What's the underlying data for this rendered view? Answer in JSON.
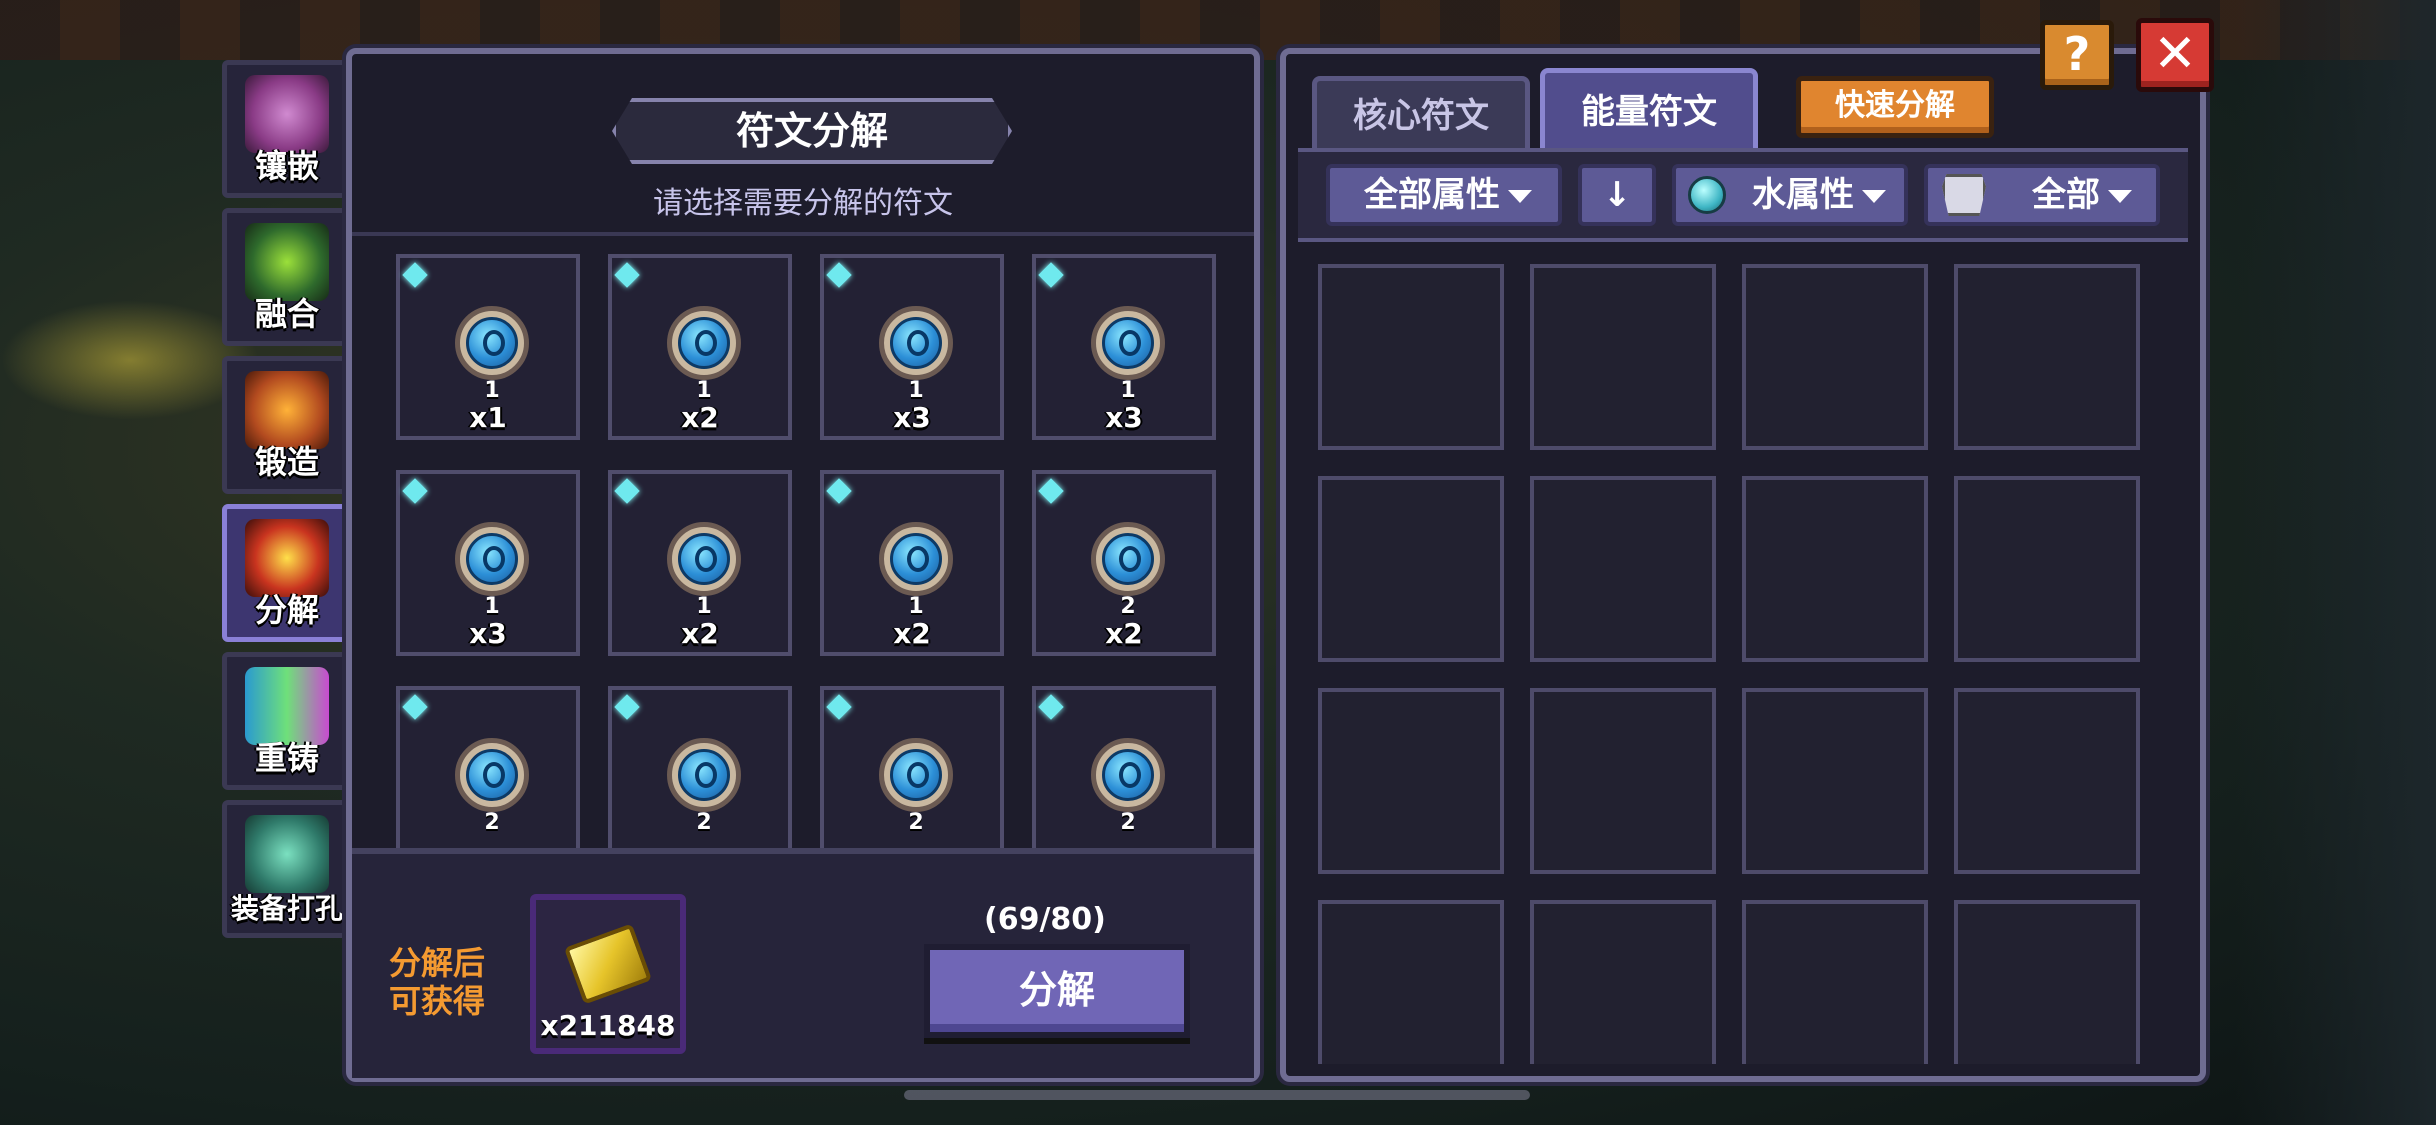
{
  "colors": {
    "panel_bg": "#1d1c2b",
    "panel_border": "#6f6c92",
    "accent_purple": "#7066b6",
    "accent_orange": "#e0852f",
    "close_red": "#d63a34",
    "rune_gem_cyan": "#6fe9ee"
  },
  "side_nav": {
    "items": [
      {
        "label": "镶嵌",
        "icon": "inlay-icon",
        "art": "#8a3b86"
      },
      {
        "label": "融合",
        "icon": "fusion-icon",
        "art": "#2e6a2c"
      },
      {
        "label": "锻造",
        "icon": "forge-icon",
        "art": "#b24a1f"
      },
      {
        "label": "分解",
        "icon": "decompose-icon",
        "art": "#c9341f",
        "active": true
      },
      {
        "label": "重铸",
        "icon": "recast-icon",
        "art": "#3f8a57"
      },
      {
        "label": "装备打孔",
        "icon": "socket-punch-icon",
        "art": "#2f7a6a"
      }
    ]
  },
  "decompose_panel": {
    "title": "符文分解",
    "subtitle": "请选择需要分解的符文",
    "runes": [
      {
        "level": "1",
        "qty": "x1"
      },
      {
        "level": "1",
        "qty": "x2"
      },
      {
        "level": "1",
        "qty": "x3"
      },
      {
        "level": "1",
        "qty": "x3"
      },
      {
        "level": "1",
        "qty": "x3"
      },
      {
        "level": "1",
        "qty": "x2"
      },
      {
        "level": "1",
        "qty": "x2"
      },
      {
        "level": "2",
        "qty": "x2"
      },
      {
        "level": "2",
        "qty": ""
      },
      {
        "level": "2",
        "qty": ""
      },
      {
        "level": "2",
        "qty": ""
      },
      {
        "level": "2",
        "qty": ""
      }
    ],
    "reward_label": "分解后 可获得",
    "reward_qty": "x211848",
    "capacity": "(69/80)",
    "decompose_button": "分解"
  },
  "rune_panel": {
    "tabs": [
      "核心符文",
      "能量符文"
    ],
    "active_tab": "能量符文",
    "quick_button": "快速分解",
    "filters": {
      "attribute": "全部属性",
      "sort_icon": "arrow-down-icon",
      "element": "水属性",
      "type": "全部"
    },
    "empty_slots": 16
  },
  "top_buttons": {
    "help": "?",
    "close": "✕"
  }
}
